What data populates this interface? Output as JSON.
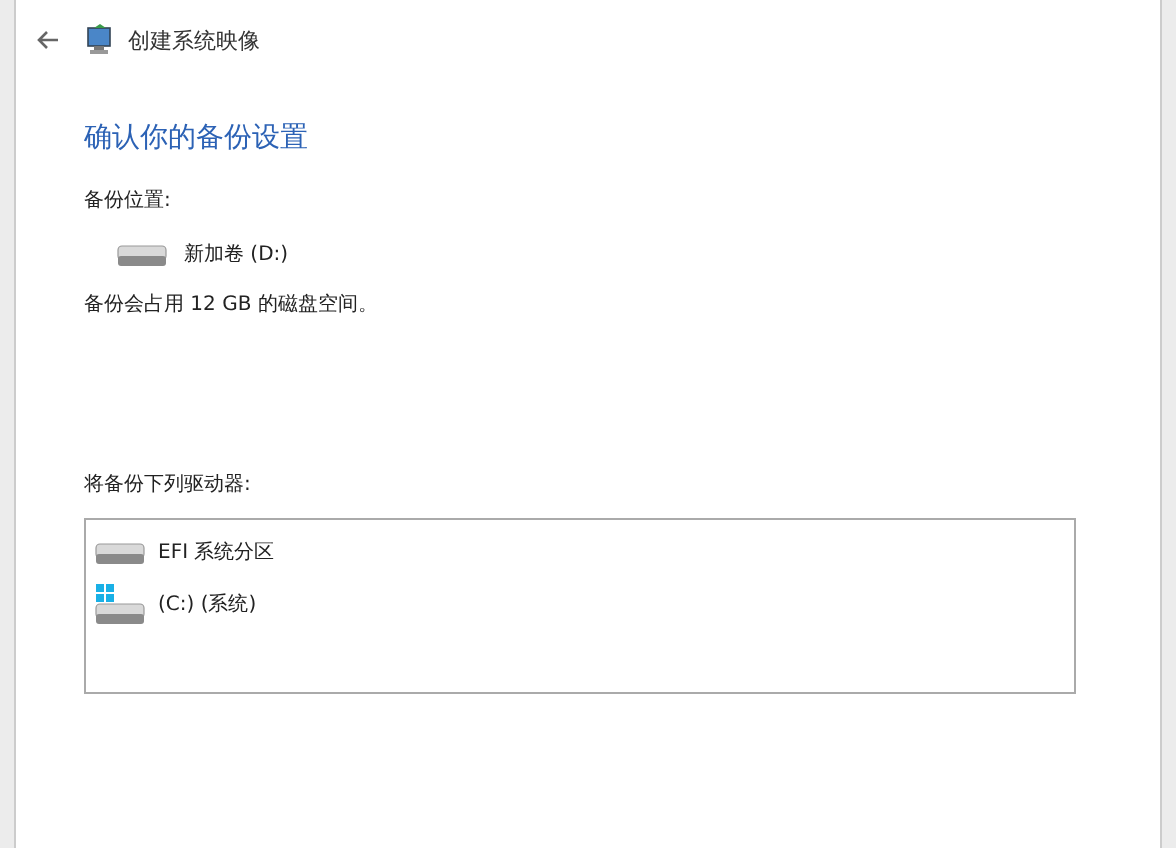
{
  "window": {
    "title": "创建系统映像"
  },
  "heading": "确认你的备份设置",
  "backup_location": {
    "label": "备份位置:",
    "drive": {
      "kind": "drive",
      "name": "新加卷 (D:)"
    }
  },
  "space_note": "备份会占用 12 GB 的磁盘空间。",
  "drives_section": {
    "label": "将备份下列驱动器:",
    "items": [
      {
        "kind": "drive",
        "name": "EFI 系统分区"
      },
      {
        "kind": "system-drive",
        "name": "(C:) (系统)"
      }
    ]
  }
}
